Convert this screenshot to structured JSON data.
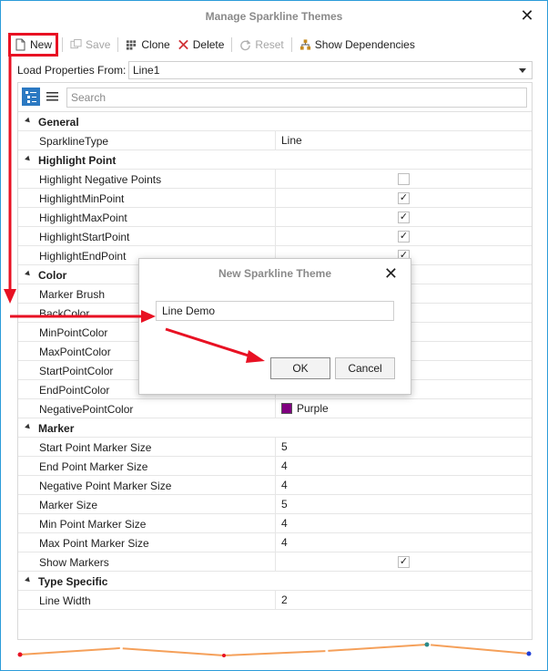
{
  "window": {
    "title": "Manage Sparkline Themes"
  },
  "toolbar": {
    "new_label": "New",
    "save_label": "Save",
    "clone_label": "Clone",
    "delete_label": "Delete",
    "reset_label": "Reset",
    "deps_label": "Show Dependencies"
  },
  "load": {
    "label": "Load Properties From:",
    "value": "Line1"
  },
  "search": {
    "placeholder": "Search"
  },
  "grid": {
    "cat_general": "General",
    "sparkline_type": {
      "name": "SparklineType",
      "value": "Line"
    },
    "cat_highlight": "Highlight Point",
    "hl_negative": {
      "name": "Highlight Negative Points",
      "checked": false
    },
    "hl_min": {
      "name": "HighlightMinPoint",
      "checked": true
    },
    "hl_max": {
      "name": "HighlightMaxPoint",
      "checked": true
    },
    "hl_start": {
      "name": "HighlightStartPoint",
      "checked": true
    },
    "hl_end": {
      "name": "HighlightEndPoint",
      "checked": true
    },
    "cat_color": "Color",
    "marker_brush": {
      "name": "Marker Brush"
    },
    "back_color": {
      "name": "BackColor"
    },
    "min_point_color": {
      "name": "MinPointColor"
    },
    "max_point_color": {
      "name": "MaxPointColor"
    },
    "start_point_color": {
      "name": "StartPointColor"
    },
    "end_point_color": {
      "name": "EndPointColor"
    },
    "negative_point_color": {
      "name": "NegativePointColor",
      "value": "Purple",
      "swatch": "#800080"
    },
    "cat_marker": "Marker",
    "start_marker_size": {
      "name": "Start Point Marker Size",
      "value": "5"
    },
    "end_marker_size": {
      "name": "End Point Marker Size",
      "value": "4"
    },
    "neg_marker_size": {
      "name": "Negative Point Marker Size",
      "value": "4"
    },
    "marker_size": {
      "name": "Marker Size",
      "value": "5"
    },
    "min_marker_size": {
      "name": "Min Point Marker Size",
      "value": "4"
    },
    "max_marker_size": {
      "name": "Max Point Marker Size",
      "value": "4"
    },
    "show_markers": {
      "name": "Show Markers",
      "checked": true
    },
    "cat_type": "Type Specific",
    "line_width": {
      "name": "Line Width",
      "value": "2"
    }
  },
  "dialog": {
    "title": "New Sparkline Theme",
    "input_value": "Line Demo",
    "ok_label": "OK",
    "cancel_label": "Cancel"
  },
  "colors": {
    "accent": "#2b79c2",
    "annotation": "#e81123",
    "sparkline": "#f5a05a"
  }
}
